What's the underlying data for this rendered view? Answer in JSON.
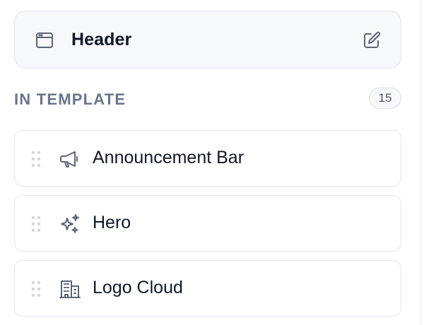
{
  "header_card": {
    "title": "Header",
    "icon": "browser-window-icon",
    "edit_icon": "pencil-square-icon"
  },
  "section": {
    "label": "IN TEMPLATE",
    "count": "15"
  },
  "items": [
    {
      "label": "Announcement Bar",
      "icon": "megaphone-icon"
    },
    {
      "label": "Hero",
      "icon": "sparkles-icon"
    },
    {
      "label": "Logo Cloud",
      "icon": "building-office-icon"
    }
  ],
  "colors": {
    "text_primary": "#111827",
    "text_muted": "#6b7589",
    "border": "#e2e5ec",
    "card_bg": "#f7f8fa",
    "icon_gray": "#5d6575"
  }
}
